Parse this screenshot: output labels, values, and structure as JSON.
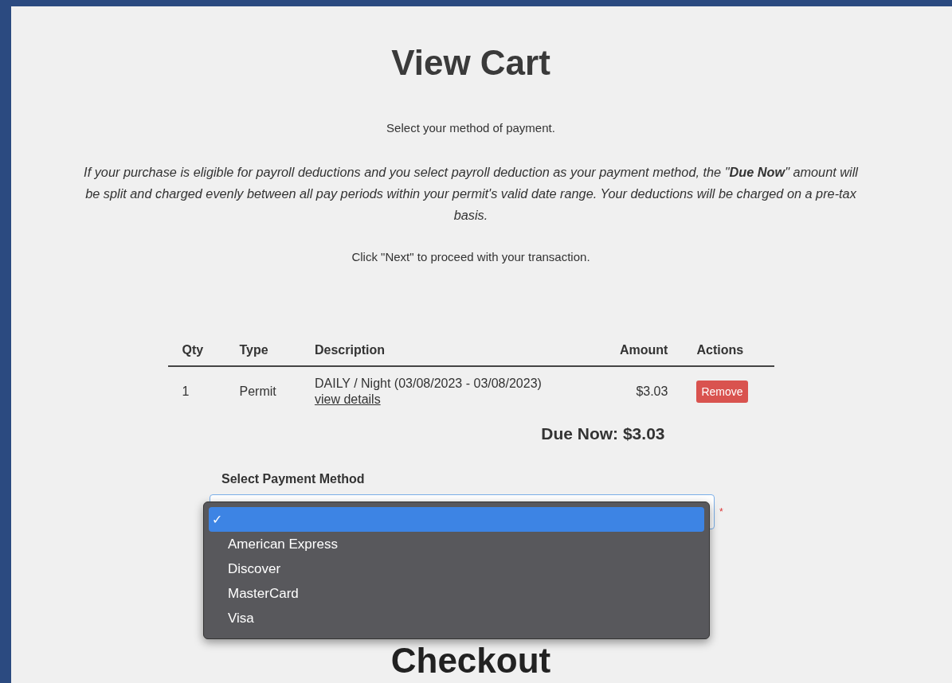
{
  "title": "View Cart",
  "intro": "Select your method of payment.",
  "note": "If your purchase is eligible for payroll deductions and you select payroll deduction as your payment method, the \"**Due Now**\" amount will be split and charged evenly between all pay periods within your permit's valid date range. Your deductions will be charged on a pre-tax basis.",
  "instruction": "Click \"Next\" to proceed with your transaction.",
  "table": {
    "columns": [
      "Qty",
      "Type",
      "Description",
      "Amount",
      "Actions"
    ],
    "rows": [
      {
        "qty": "1",
        "type": "Permit",
        "description": "DAILY / Night (03/08/2023 - 03/08/2023)",
        "details_link": "view details",
        "amount": "$3.03",
        "action": "Remove"
      }
    ]
  },
  "due_now": "Due Now: $3.03",
  "payment": {
    "label": "Select Payment Method",
    "required_mark": "*",
    "check_glyph": "✓",
    "options": [
      {
        "selected": true
      },
      {
        "label": "American Express",
        "selected": false
      },
      {
        "label": "Discover",
        "selected": false
      },
      {
        "label": "MasterCard",
        "selected": false
      },
      {
        "label": "Visa",
        "selected": false
      }
    ]
  },
  "checkout_heading": "Checkout"
}
